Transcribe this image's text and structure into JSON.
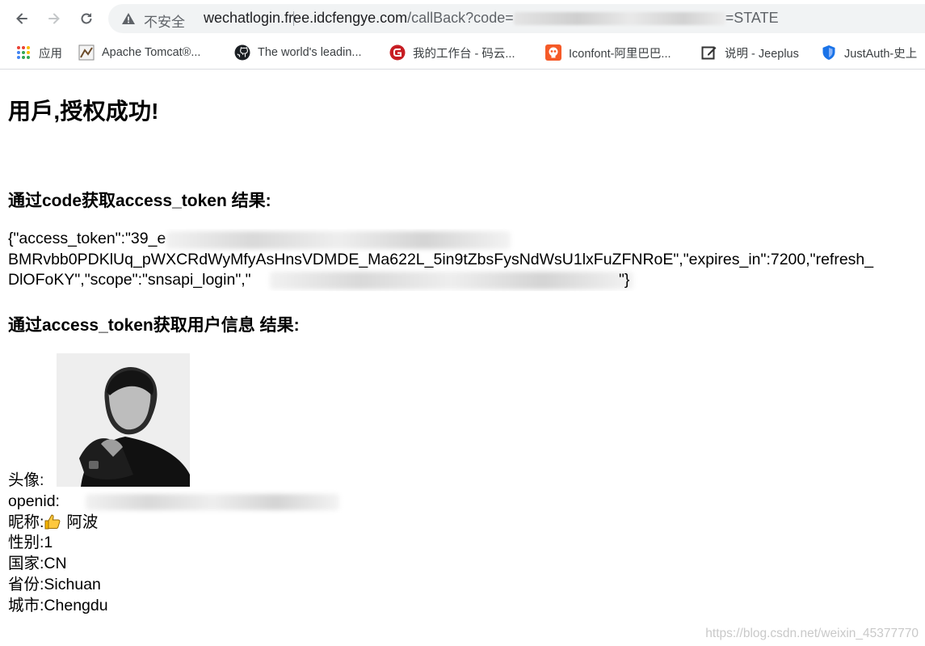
{
  "browser": {
    "security_label": "不安全",
    "url_host": "wechatlogin.free.idcfengye.com",
    "url_path": "/callBack?code=",
    "url_tail": "=STATE"
  },
  "bookmarks": [
    {
      "label": "应用",
      "icon": "apps-grid-icon"
    },
    {
      "label": "Apache Tomcat®...",
      "icon": "tomcat-icon"
    },
    {
      "label": "The world's leadin...",
      "icon": "github-icon"
    },
    {
      "label": "我的工作台 - 码云...",
      "icon": "gitee-icon"
    },
    {
      "label": "Iconfont-阿里巴巴...",
      "icon": "iconfont-icon"
    },
    {
      "label": "说明 - Jeeplus",
      "icon": "edit-note-icon"
    },
    {
      "label": "JustAuth-史上",
      "icon": "shield-icon"
    }
  ],
  "page": {
    "title": "用戶,授权成功!",
    "section_token_heading": "通过code获取access_token 结果:",
    "token_line1_prefix": "{\"access_token\":\"39_e",
    "token_line2": "BMRvbb0PDKlUq_pWXCRdWyMfyAsHnsVDMDE_Ma622L_5in9tZbsFysNdWsU1lxFuZFNRoE\",\"expires_in\":7200,\"refresh_",
    "token_line3_prefix": "DlOFoKY\",\"scope\":\"snsapi_login\",\"",
    "token_line3_suffix": "\"}",
    "section_user_heading": "通过access_token获取用户信息 结果:",
    "avatar_label": "头像:",
    "openid_label": "openid:",
    "nickname_label": "昵称:",
    "nickname_value": "阿波",
    "gender_label": "性别:",
    "gender_value": "1",
    "country_label": "国家:",
    "country_value": "CN",
    "province_label": "省份:",
    "province_value": "Sichuan",
    "city_label": "城市:",
    "city_value": "Chengdu"
  },
  "watermark": "https://blog.csdn.net/weixin_45377770"
}
